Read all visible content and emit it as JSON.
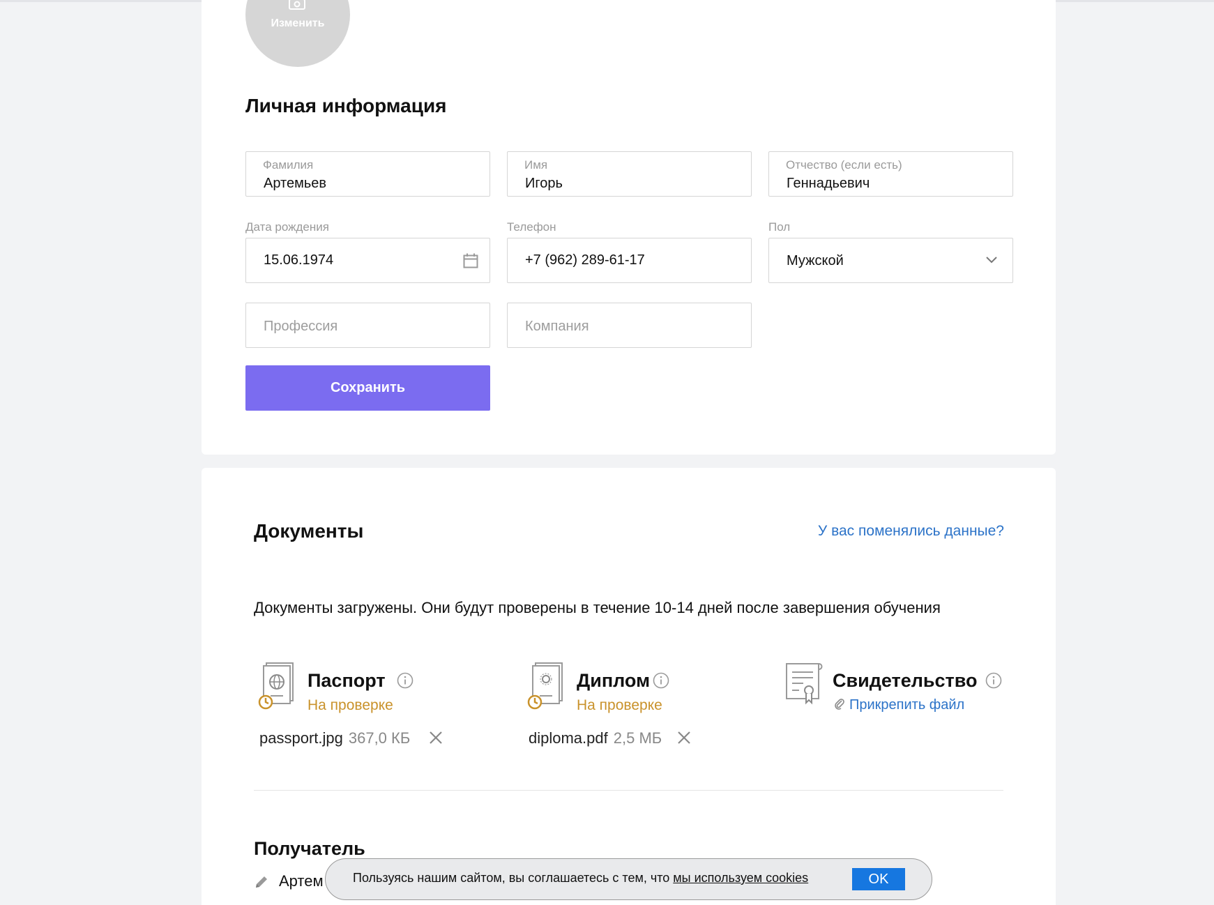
{
  "profile": {
    "avatar_label": "Изменить",
    "section_title": "Личная информация",
    "fields": {
      "last_name": {
        "label": "Фамилия",
        "value": "Артемьев"
      },
      "first_name": {
        "label": "Имя",
        "value": "Игорь"
      },
      "patronymic": {
        "label": "Отчество (если есть)",
        "value": "Геннадьевич"
      },
      "birth_date": {
        "label": "Дата рождения",
        "value": "15.06.1974"
      },
      "phone": {
        "label": "Телефон",
        "value": "+7 (962) 289-61-17"
      },
      "gender": {
        "label": "Пол",
        "value": "Мужской"
      },
      "profession": {
        "placeholder": "Профессия"
      },
      "company": {
        "placeholder": "Компания"
      }
    },
    "save_label": "Сохранить"
  },
  "documents": {
    "title": "Документы",
    "changed_link": "У вас поменялись данные?",
    "note": "Документы загружены. Они будут проверены в течение 10-14 дней после завершения обучения",
    "items": [
      {
        "title": "Паспорт",
        "status": "На проверке",
        "file_name": "passport.jpg",
        "file_size": "367,0 КБ",
        "icon": "passport-icon"
      },
      {
        "title": "Диплом",
        "status": "На проверке",
        "file_name": "diploma.pdf",
        "file_size": "2,5 МБ",
        "icon": "diploma-icon"
      },
      {
        "title": "Свидетельство",
        "attach_label": "Прикрепить файл",
        "icon": "certificate-icon"
      }
    ],
    "status_color": "#c9922b",
    "link_color": "#2c73c8"
  },
  "recipient": {
    "title": "Получатель",
    "name_partial": "Артем"
  },
  "cookie_banner": {
    "text": "Пользуясь нашим сайтом, вы соглашаетесь с тем, что ",
    "link": "мы используем cookies",
    "ok_label": "OK"
  },
  "colors": {
    "accent": "#7b6cf0",
    "ok_button": "#1677e0"
  }
}
